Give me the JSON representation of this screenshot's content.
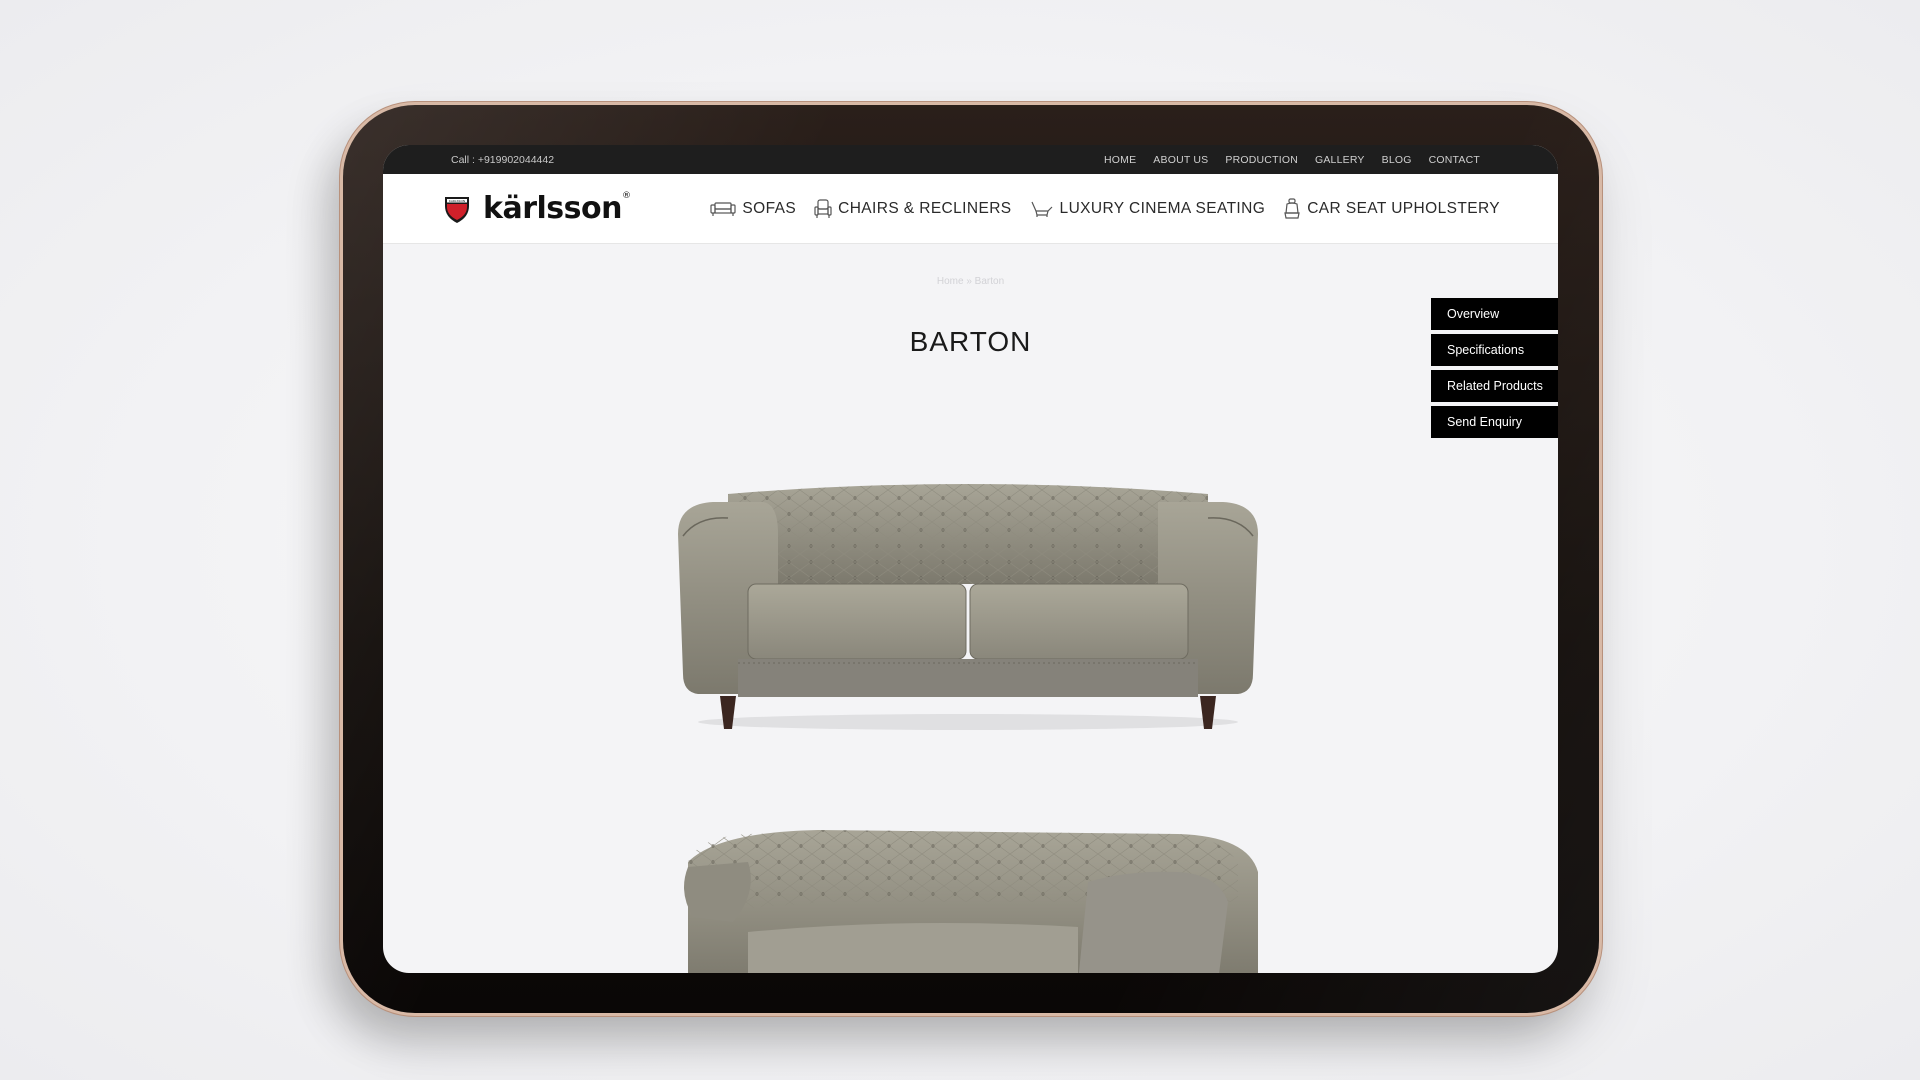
{
  "topbar": {
    "phone": "Call : +919902044442",
    "nav": [
      "HOME",
      "ABOUT US",
      "PRODUCTION",
      "GALLERY",
      "BLOG",
      "CONTACT"
    ]
  },
  "header": {
    "brand": "kärlsson",
    "brand_mark": "®",
    "logo_badge_text": "KARLSSON",
    "nav": [
      {
        "label": "SOFAS",
        "icon": "sofa-icon"
      },
      {
        "label": "CHAIRS & RECLINERS",
        "icon": "chair-icon"
      },
      {
        "label": "LUXURY CINEMA SEATING",
        "icon": "recliner-icon"
      },
      {
        "label": "CAR SEAT UPHOLSTERY",
        "icon": "car-seat-icon"
      }
    ]
  },
  "breadcrumb": {
    "home": "Home",
    "separator": "»",
    "current": "Barton"
  },
  "product": {
    "title": "BARTON"
  },
  "side_tabs": [
    "Overview",
    "Specifications",
    "Related Products",
    "Send Enquiry"
  ],
  "colors": {
    "brand_red": "#d0202a",
    "sofa_leather": "#8f8c80",
    "topbar": "#1e1e1e"
  }
}
